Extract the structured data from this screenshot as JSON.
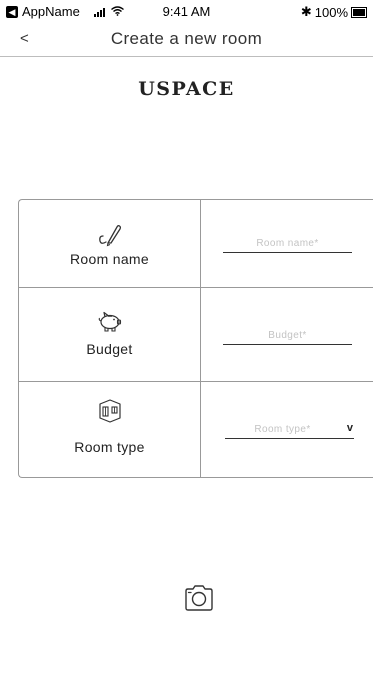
{
  "status_bar": {
    "app_name": "AppName",
    "time": "9:41 AM",
    "bluetooth": "✱",
    "battery_percent": "100%"
  },
  "nav": {
    "back_label": "<",
    "title": "Create a new room"
  },
  "brand": {
    "name": "USPACE"
  },
  "form": {
    "room_name": {
      "label": "Room name",
      "placeholder": "Room name*",
      "icon": "pen-icon"
    },
    "budget": {
      "label": "Budget",
      "placeholder": "Budget*",
      "icon": "piggy-bank-icon"
    },
    "room_type": {
      "label": "Room type",
      "placeholder": "Room type*",
      "arrow": "v",
      "icon": "room-box-icon"
    }
  },
  "camera": {
    "icon": "camera-icon"
  }
}
